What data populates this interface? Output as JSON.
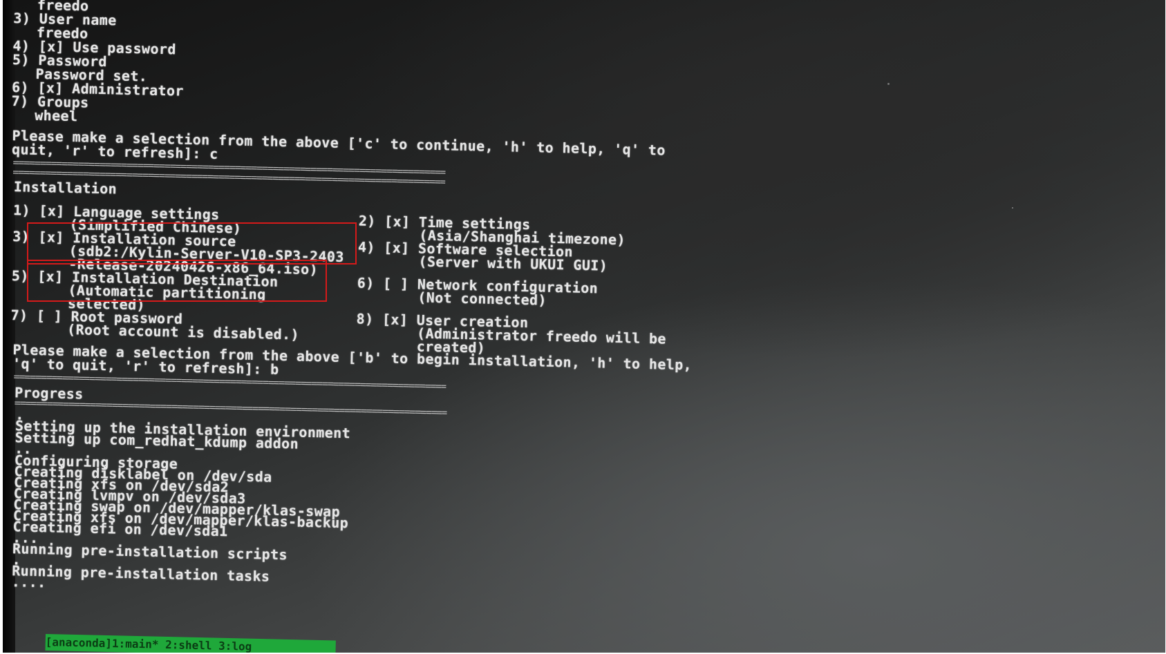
{
  "top": {
    "line_freedo_partial": "freedo",
    "item3": "3) User name",
    "item3_value": "freedo",
    "item4": "4) [x] Use password",
    "item5": "5) Password",
    "item5_value": "Password set.",
    "item6": "6) [x] Administrator",
    "item7": "7) Groups",
    "item7_value": "wheel",
    "prompt_line1": "Please make a selection from the above ['c' to continue, 'h' to help, 'q' to",
    "prompt_line2": "quit, 'r' to refresh]: c"
  },
  "separator": "================================================================================",
  "installation": {
    "title": "Installation",
    "left": [
      {
        "label": "1) [x] Language settings",
        "detail": [
          "(Simplified Chinese)"
        ]
      },
      {
        "label": "3) [x] Installation source",
        "detail": [
          "(sdb2:/Kylin-Server-V10-SP3-2403",
          "-Release-20240426-x86_64.iso)"
        ]
      },
      {
        "label": "5) [x] Installation Destination",
        "detail": [
          "(Automatic partitioning",
          "selected)"
        ]
      },
      {
        "label": "7) [ ] Root password",
        "detail": [
          "(Root account is disabled.)"
        ]
      }
    ],
    "right": [
      {
        "label": "2) [x] Time settings",
        "detail": [
          "(Asia/Shanghai timezone)"
        ]
      },
      {
        "label": "4) [x] Software selection",
        "detail": [
          "(Server with UKUI GUI)"
        ]
      },
      {
        "label": "6) [ ] Network configuration",
        "detail": [
          "(Not connected)"
        ]
      },
      {
        "label": "8) [x] User creation",
        "detail": [
          "(Administrator freedo will be",
          "created)"
        ]
      }
    ],
    "prompt_line1": "Please make a selection from the above ['b' to begin installation, 'h' to help,",
    "prompt_line2": "'q' to quit, 'r' to refresh]: b"
  },
  "progress": {
    "title": "Progress",
    "lines": [
      ".",
      "Setting up the installation environment",
      "Setting up com_redhat_kdump addon",
      "..",
      "Configuring storage",
      "Creating disklabel on /dev/sda",
      "Creating xfs on /dev/sda2",
      "Creating lvmpv on /dev/sda3",
      "Creating swap on /dev/mapper/klas-swap",
      "Creating xfs on /dev/mapper/klas-backup",
      "Creating efi on /dev/sda1",
      "...",
      "Running pre-installation scripts",
      ".",
      "Running pre-installation tasks",
      "...."
    ]
  },
  "statusbar": "[anaconda]1:main* 2:shell 3:log",
  "colors": {
    "terminal_text": "#e6e6e6",
    "highlight_box": "#d61a1a",
    "statusbar_bg": "#1fa83a"
  }
}
